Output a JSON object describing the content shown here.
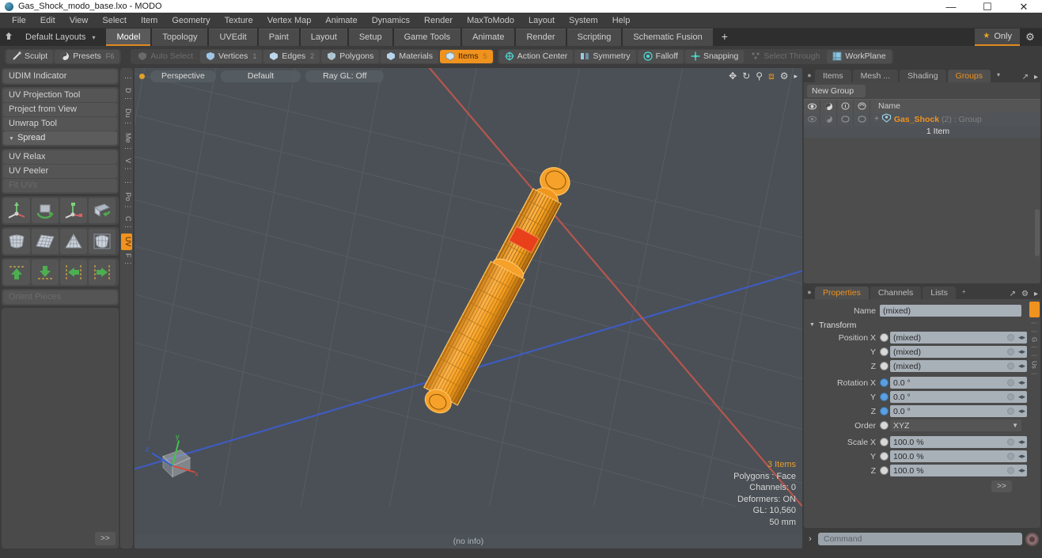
{
  "window": {
    "title": "Gas_Shock_modo_base.lxo - MODO",
    "app_icon": "modo-sphere-icon",
    "minimize": "—",
    "maximize": "☐",
    "close": "✕"
  },
  "menubar": {
    "items": [
      "File",
      "Edit",
      "View",
      "Select",
      "Item",
      "Geometry",
      "Texture",
      "Vertex Map",
      "Animate",
      "Dynamics",
      "Render",
      "MaxToModo",
      "Layout",
      "System",
      "Help"
    ]
  },
  "layout_row": {
    "home_icon": "home-icon",
    "default_layouts": "Default Layouts",
    "caret": "▾",
    "tabs": [
      {
        "label": "Model",
        "selected": true
      },
      {
        "label": "Topology",
        "selected": false
      },
      {
        "label": "UVEdit",
        "selected": false
      },
      {
        "label": "Paint",
        "selected": false
      },
      {
        "label": "Layout",
        "selected": false
      },
      {
        "label": "Setup",
        "selected": false
      },
      {
        "label": "Game Tools",
        "selected": false
      },
      {
        "label": "Animate",
        "selected": false
      },
      {
        "label": "Render",
        "selected": false
      },
      {
        "label": "Scripting",
        "selected": false
      },
      {
        "label": "Schematic Fusion",
        "selected": false
      }
    ],
    "add_tab": "+",
    "only_label": "Only",
    "star_icon": "star-icon",
    "gear_icon": "gear-icon"
  },
  "modebar": {
    "group_left": [
      {
        "label": "Sculpt",
        "icon": "brush-icon",
        "state": "normal"
      },
      {
        "label": "Presets",
        "icon": "sphere-icon",
        "state": "normal",
        "suffix": "F6"
      }
    ],
    "group_select": [
      {
        "label": "Auto Select",
        "icon": "shield-icon",
        "state": "dim",
        "count": ""
      },
      {
        "label": "Vertices",
        "icon": "vertices-icon",
        "state": "normal",
        "count": "1"
      },
      {
        "label": "Edges",
        "icon": "edges-icon",
        "state": "normal",
        "count": "2"
      },
      {
        "label": "Polygons",
        "icon": "polygons-icon",
        "state": "normal",
        "count": ""
      },
      {
        "label": "Materials",
        "icon": "materials-icon",
        "state": "normal",
        "count": ""
      },
      {
        "label": "Items",
        "icon": "items-icon",
        "state": "selected",
        "count": "5"
      }
    ],
    "group_right": [
      {
        "label": "Action Center",
        "icon": "target-icon",
        "state": "normal"
      },
      {
        "label": "Symmetry",
        "icon": "symmetry-icon",
        "state": "normal"
      },
      {
        "label": "Falloff",
        "icon": "falloff-icon",
        "state": "normal"
      },
      {
        "label": "Snapping",
        "icon": "snapping-icon",
        "state": "normal"
      },
      {
        "label": "Select Through",
        "icon": "select-through-icon",
        "state": "dim"
      },
      {
        "label": "WorkPlane",
        "icon": "workplane-icon",
        "state": "normal"
      }
    ]
  },
  "left_toolbox": {
    "group1": [
      {
        "label": "UDIM Indicator",
        "dim": false,
        "header": false
      }
    ],
    "group2": [
      {
        "label": "UV Projection Tool",
        "dim": false,
        "header": false
      },
      {
        "label": "Project from View",
        "dim": false,
        "header": false
      },
      {
        "label": "Unwrap Tool",
        "dim": false,
        "header": false
      },
      {
        "label": "Spread",
        "dim": false,
        "header": true
      }
    ],
    "group3": [
      {
        "label": "UV Relax",
        "dim": false,
        "header": false
      },
      {
        "label": "UV Peeler",
        "dim": false,
        "header": false
      },
      {
        "label": "Fit UVs",
        "dim": true,
        "header": false
      }
    ],
    "icon_rows": [
      [
        "uv-move-icon",
        "uv-rotate-icon",
        "uv-scale-icon",
        "uv-flip-icon"
      ],
      [
        "uv-fit-icon",
        "uv-grid-icon",
        "uv-cone-icon",
        "uv-sphere-icon"
      ],
      [
        "uv-align-up-icon",
        "uv-align-down-icon",
        "uv-align-left-icon",
        "uv-align-right-icon"
      ]
    ],
    "group4": [
      {
        "label": "Orient Pieces",
        "dim": true,
        "header": false
      }
    ],
    "more_button": ">>",
    "vertical_tabs": [
      {
        "label": "⋮",
        "selected": false
      },
      {
        "label": "D ⋮",
        "selected": false
      },
      {
        "label": "Du ⋮",
        "selected": false
      },
      {
        "label": "Me ⋮",
        "selected": false
      },
      {
        "label": "V ⋮",
        "selected": false
      },
      {
        "label": "⋮",
        "selected": false
      },
      {
        "label": "Po ⋮",
        "selected": false
      },
      {
        "label": "C ⋮",
        "selected": false
      },
      {
        "label": "UV",
        "selected": true
      },
      {
        "label": "F ⋮",
        "selected": false
      }
    ]
  },
  "viewport": {
    "dot_icon": "viewport-dot-icon",
    "buttons": [
      "Perspective",
      "Default",
      "Ray GL: Off"
    ],
    "tools": [
      {
        "icon": "pan-icon",
        "accent": false
      },
      {
        "icon": "rotate-icon",
        "accent": false
      },
      {
        "icon": "zoom-icon",
        "accent": false
      },
      {
        "icon": "fit-icon",
        "accent": true
      },
      {
        "icon": "gear-icon",
        "accent": false
      },
      {
        "icon": "arrow-right-icon",
        "accent": false
      }
    ],
    "stats": [
      {
        "text": "3 Items",
        "accent": true
      },
      {
        "text": "Polygons : Face",
        "accent": false
      },
      {
        "text": "Channels: 0",
        "accent": false
      },
      {
        "text": "Deformers: ON",
        "accent": false
      },
      {
        "text": "GL: 10,560",
        "accent": false
      },
      {
        "text": "50 mm",
        "accent": false
      }
    ],
    "status": "(no info)",
    "axis_gizmo": {
      "x": "x",
      "y": "y",
      "z": "z"
    }
  },
  "groups_panel": {
    "tabs": [
      {
        "label": "Items",
        "selected": false
      },
      {
        "label": "Mesh ...",
        "selected": false
      },
      {
        "label": "Shading",
        "selected": false
      },
      {
        "label": "Groups",
        "selected": true
      }
    ],
    "dropdown_caret": "▾",
    "expand_icon": "expand-icon",
    "arrow_icon": "arrow-right-icon",
    "new_group_button": "New Group",
    "column_icons": [
      "visibility-icon",
      "render-icon",
      "lock-icon",
      "wireframe-icon"
    ],
    "name_column": "Name",
    "rows": [
      {
        "plus": "+",
        "icon": "group-icon",
        "name": "Gas_Shock",
        "meta": "(2) : Group",
        "sub": "1 Item"
      }
    ]
  },
  "properties_panel": {
    "tabs": [
      {
        "label": "Properties",
        "selected": true
      },
      {
        "label": "Channels",
        "selected": false
      },
      {
        "label": "Lists",
        "selected": false
      }
    ],
    "add_tab": "+",
    "expand_icon": "expand-icon",
    "gear_icon": "gear-icon",
    "arrow_icon": "arrow-right-icon",
    "name_label": "Name",
    "name_value": "(mixed)",
    "transform_header": "Transform",
    "fields": [
      {
        "label": "Position X",
        "value": "(mixed)",
        "dot": "white",
        "type": "value"
      },
      {
        "label": "Y",
        "value": "(mixed)",
        "dot": "white",
        "type": "value"
      },
      {
        "label": "Z",
        "value": "(mixed)",
        "dot": "white",
        "type": "value"
      },
      {
        "label": "Rotation X",
        "value": "0.0 °",
        "dot": "blue",
        "type": "value"
      },
      {
        "label": "Y",
        "value": "0.0 °",
        "dot": "blue",
        "type": "value"
      },
      {
        "label": "Z",
        "value": "0.0 °",
        "dot": "blue",
        "type": "value"
      },
      {
        "label": "Order",
        "value": "XYZ",
        "dot": "white",
        "type": "dropdown"
      },
      {
        "label": "Scale X",
        "value": "100.0 %",
        "dot": "white",
        "type": "value"
      },
      {
        "label": "Y",
        "value": "100.0 %",
        "dot": "white",
        "type": "value"
      },
      {
        "label": "Z",
        "value": "100.0 %",
        "dot": "white",
        "type": "value"
      }
    ],
    "more_button": ">>",
    "side_tabs": [
      "⋮",
      "⋮",
      "G ⋮",
      "⋮",
      "Us ⋮"
    ]
  },
  "command_bar": {
    "prompt": "›",
    "placeholder": "Command",
    "record_icon": "record-icon"
  },
  "colors": {
    "accent": "#f0921e",
    "panel": "#4a4a4a",
    "background": "#3c3c3c",
    "viewport": "#4a5055",
    "field": "#a8b0b8",
    "axis_x": "#b5564f",
    "axis_z": "#3b55a8",
    "selection": "#f59e1e"
  }
}
